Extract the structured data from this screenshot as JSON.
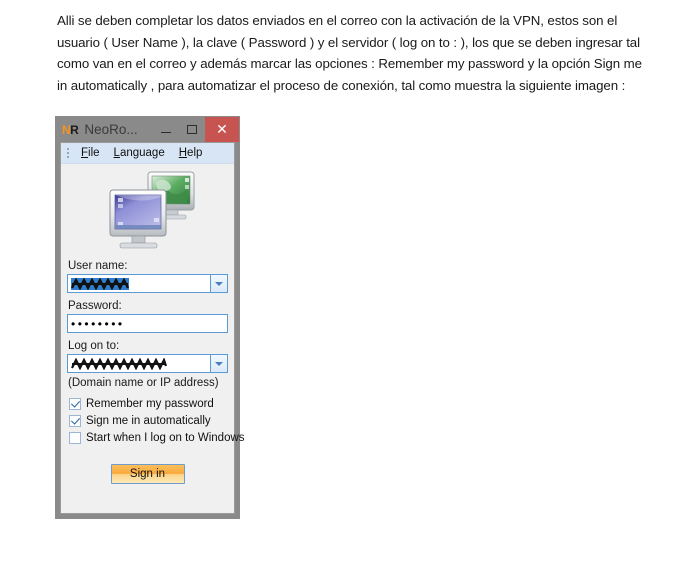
{
  "document": {
    "paragraph": "Alli se deben completar los datos enviados en el correo con la activación de la VPN, estos son el usuario ( User Name ), la clave ( Password )  y el servidor ( log on to : ), los que se deben ingresar tal como van en el correo y además marcar las opciones : Remember my password y la opción Sign me in automatically , para automatizar el proceso de conexión, tal como muestra la siguiente imagen :"
  },
  "window": {
    "logo_n": "N",
    "logo_r": "R",
    "title": "NeoRo...",
    "buttons": {
      "minimize": "minimize-icon",
      "maximize": "maximize-icon",
      "close": "✕"
    },
    "menu": [
      {
        "label_before": "",
        "accel": "F",
        "label_after": "ile"
      },
      {
        "label_before": "",
        "accel": "L",
        "label_after": "anguage"
      },
      {
        "label_before": "",
        "accel": "H",
        "label_after": "elp"
      }
    ],
    "hero_icon": "two-monitors-remote-desktop-icon",
    "form": {
      "username_label": "User name:",
      "username_value": "",
      "password_label": "Password:",
      "password_value": "••••••••",
      "logon_label": "Log on to:",
      "logon_value": "",
      "logon_hint": "(Domain name or IP address)"
    },
    "checkboxes": [
      {
        "label": "Remember my password",
        "checked": true
      },
      {
        "label": "Sign me in automatically",
        "checked": true
      },
      {
        "label": "Start when I log on to Windows",
        "checked": false
      }
    ],
    "signin_label": "Sign in"
  },
  "colors": {
    "titlebar": "#8a8a8a",
    "close_button": "#c75450",
    "menubar": "#d7e5f5",
    "client": "#f0f0f0",
    "field_border": "#5b9bd5",
    "logo_orange": "#f7941e",
    "signin_orange": "#f8a93c",
    "selection_blue": "#2f7fd1"
  }
}
